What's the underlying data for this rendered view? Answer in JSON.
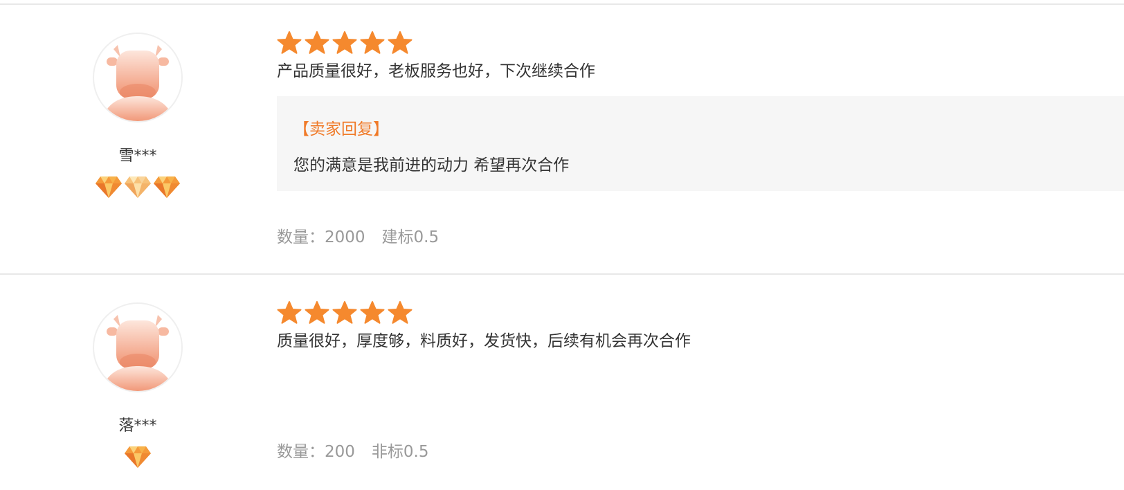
{
  "reviews": [
    {
      "avatar_icon": "cow-avatar-icon",
      "username": "雪***",
      "level_icons": [
        "diamond-level-icon",
        "diamond-level-icon",
        "diamond-level-icon"
      ],
      "rating": 5,
      "rating_max": 5,
      "comment": "产品质量很好，老板服务也好，下次继续合作",
      "seller_reply": {
        "title": "【卖家回复】",
        "text": "您的满意是我前进的动力 希望再次合作"
      },
      "quantity": "数量：2000",
      "spec": "建标0.5"
    },
    {
      "avatar_icon": "cow-avatar-icon",
      "username": "落***",
      "level_icons": [
        "diamond-level-icon"
      ],
      "rating": 5,
      "rating_max": 5,
      "comment": "质量很好，厚度够，料质好，发货快，后续有机会再次合作",
      "quantity": "数量：200",
      "spec": "非标0.5"
    }
  ],
  "colors": {
    "star": "#f5892e",
    "reply_title": "#f07a28",
    "meta_text": "#999999",
    "body_text": "#333333",
    "reply_bg": "#f6f6f6",
    "avatar_gradient_top": "#fde3d8",
    "avatar_gradient_bottom": "#f29070"
  }
}
